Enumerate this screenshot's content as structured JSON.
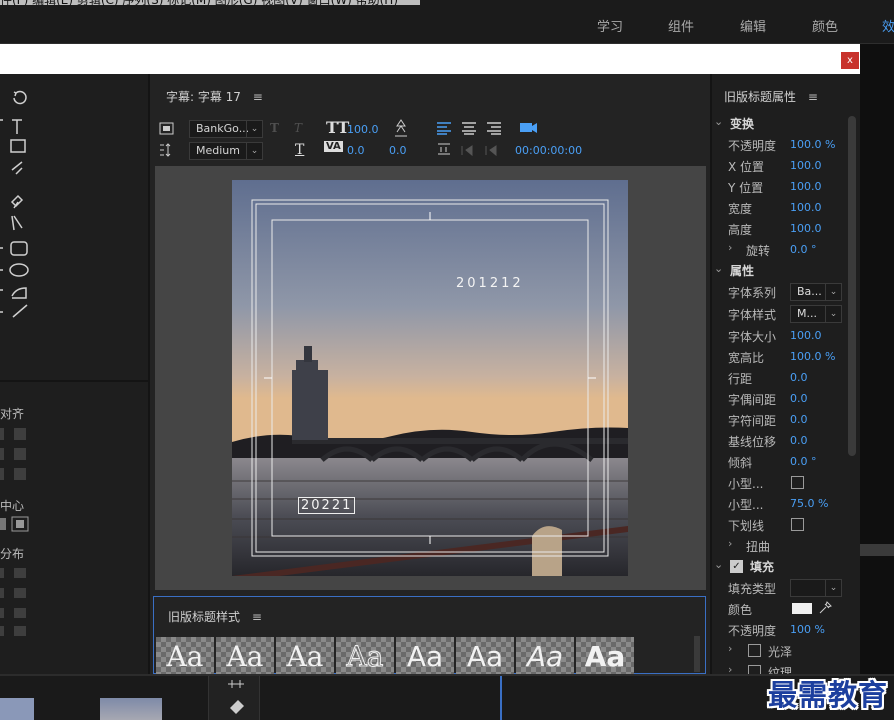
{
  "menubar": {
    "fragment": "件(F)  编辑(E)  剪辑(C)  序列(S)  标记(M)  图形(G)  视图(V)  窗口(W)  帮助(H)"
  },
  "workspace_tabs": [
    "学习",
    "组件",
    "编辑",
    "颜色",
    "效"
  ],
  "close_label": "x",
  "tools": {
    "align_label": "对齐",
    "center_label": "中心",
    "distribute_label": "分布"
  },
  "title_panel": {
    "title": "字幕: 字幕 17",
    "font_family": "BankGo...",
    "font_style": "Medium",
    "font_size": "100.0",
    "kerning": "0.0",
    "leading": "0.0",
    "timecode": "00:00:00:00",
    "canvas_text_1": "201212",
    "canvas_text_2": "20221"
  },
  "styles_panel": {
    "title": "旧版标题样式",
    "swatches": [
      "Aa",
      "Aa",
      "Aa",
      "Aa",
      "Aa",
      "Aa",
      "Aa",
      "Aa"
    ]
  },
  "properties": {
    "title": "旧版标题属性",
    "transform_section": "变换",
    "opacity": {
      "label": "不透明度",
      "value": "100.0 %"
    },
    "x_pos": {
      "label": "X 位置",
      "value": "100.0"
    },
    "y_pos": {
      "label": "Y 位置",
      "value": "100.0"
    },
    "width": {
      "label": "宽度",
      "value": "100.0"
    },
    "height": {
      "label": "高度",
      "value": "100.0"
    },
    "rotation": {
      "label": "旋转",
      "value": "0.0 °"
    },
    "props_section": "属性",
    "font_family": {
      "label": "字体系列",
      "value": "Ba..."
    },
    "font_style": {
      "label": "字体样式",
      "value": "M..."
    },
    "font_size": {
      "label": "字体大小",
      "value": "100.0"
    },
    "aspect": {
      "label": "宽高比",
      "value": "100.0 %"
    },
    "leading": {
      "label": "行距",
      "value": "0.0"
    },
    "kerning": {
      "label": "字偶间距",
      "value": "0.0"
    },
    "tracking": {
      "label": "字符间距",
      "value": "0.0"
    },
    "baseline": {
      "label": "基线位移",
      "value": "0.0"
    },
    "slant": {
      "label": "倾斜",
      "value": "0.0 °"
    },
    "small_caps": {
      "label": "小型..."
    },
    "small_caps_size": {
      "label": "小型...",
      "value": "75.0 %"
    },
    "underline": {
      "label": "下划线"
    },
    "distort": {
      "label": "扭曲"
    },
    "fill_section": "填充",
    "fill_type": {
      "label": "填充类型"
    },
    "color": {
      "label": "颜色"
    },
    "fill_opacity": {
      "label": "不透明度",
      "value": "100 %"
    },
    "sheen": {
      "label": "光泽"
    },
    "texture": {
      "label": "纹理"
    }
  },
  "watermark": "最需教育",
  "colors": {
    "accent": "#4a9ff5",
    "panel": "#1e1e1e",
    "canvas": "#454545",
    "close": "#c8322c"
  }
}
